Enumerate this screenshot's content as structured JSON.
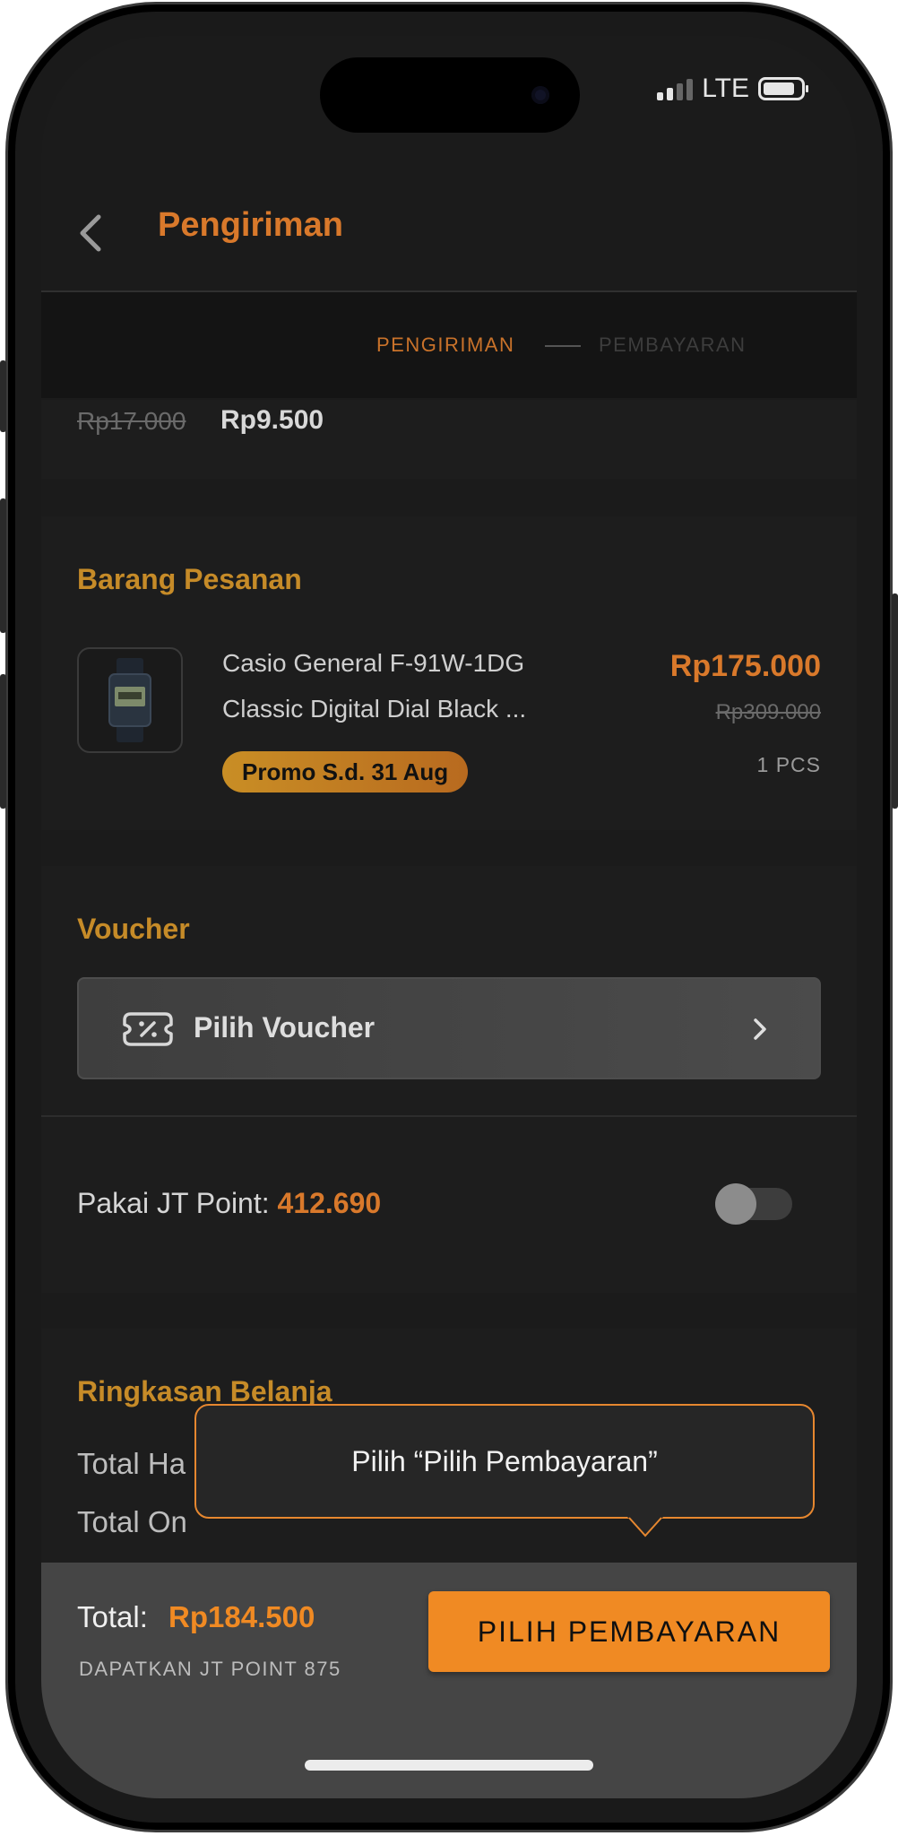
{
  "status_bar": {
    "network": "LTE"
  },
  "header": {
    "title": "Pengiriman",
    "back_icon": "chevron-left-icon"
  },
  "steps": {
    "step1": "PENGIRIMAN",
    "step2": "PEMBAYARAN"
  },
  "shipping": {
    "old_price": "Rp17.000",
    "new_price": "Rp9.500"
  },
  "order": {
    "section_title": "Barang Pesanan",
    "product": {
      "name_line1": "Casio General F-91W-1DG",
      "name_line2": "Classic Digital Dial Black ...",
      "promo": "Promo S.d. 31 Aug",
      "price": "Rp175.000",
      "old_price": "Rp309.000",
      "qty": "1 PCS"
    }
  },
  "voucher": {
    "section_title": "Voucher",
    "button_label": "Pilih Voucher",
    "icon": "ticket-percent-icon"
  },
  "points": {
    "label": "Pakai JT Point:",
    "value": "412.690",
    "toggle_on": false
  },
  "summary": {
    "section_title": "Ringkasan Belanja",
    "row1_label": "Total Ha",
    "row2_label": "Total On"
  },
  "tooltip": {
    "text": "Pilih “Pilih Pembayaran”"
  },
  "footer": {
    "total_label": "Total:",
    "total_value": "Rp184.500",
    "points_note": "DAPATKAN JT POINT 875",
    "pay_button": "PILIH PEMBAYARAN"
  },
  "colors": {
    "accent_orange": "#f08a23",
    "title_orange": "#d9792b",
    "section_gold": "#c68b28",
    "background": "#1b1b1b"
  }
}
